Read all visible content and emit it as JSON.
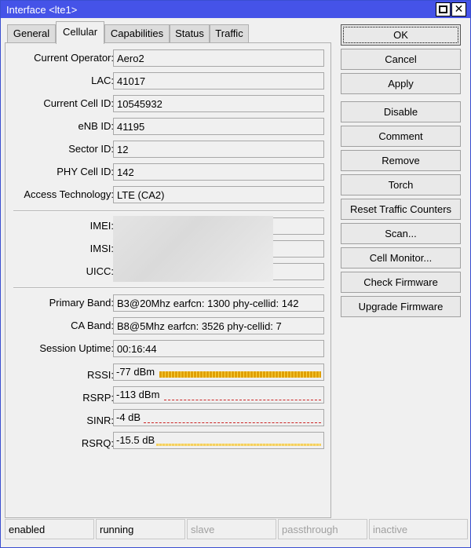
{
  "window": {
    "title": "Interface <lte1>"
  },
  "tabs": [
    {
      "label": "General"
    },
    {
      "label": "Cellular"
    },
    {
      "label": "Capabilities"
    },
    {
      "label": "Status"
    },
    {
      "label": "Traffic"
    }
  ],
  "active_tab": "Cellular",
  "fields": {
    "current_operator": {
      "label": "Current Operator:",
      "value": "Aero2"
    },
    "lac": {
      "label": "LAC:",
      "value": "41017"
    },
    "current_cell_id": {
      "label": "Current Cell ID:",
      "value": "10545932"
    },
    "enb_id": {
      "label": "eNB ID:",
      "value": "41195"
    },
    "sector_id": {
      "label": "Sector ID:",
      "value": "12"
    },
    "phy_cell_id": {
      "label": "PHY Cell ID:",
      "value": "142"
    },
    "access_technology": {
      "label": "Access Technology:",
      "value": "LTE (CA2)"
    },
    "imei": {
      "label": "IMEI:",
      "value": ""
    },
    "imsi": {
      "label": "IMSI:",
      "value": ""
    },
    "uicc": {
      "label": "UICC:",
      "value": ""
    },
    "primary_band": {
      "label": "Primary Band:",
      "value": "B3@20Mhz earfcn: 1300 phy-cellid: 142"
    },
    "ca_band": {
      "label": "CA Band:",
      "value": "B8@5Mhz earfcn: 3526 phy-cellid: 7"
    },
    "session_uptime": {
      "label": "Session Uptime:",
      "value": "00:16:44"
    }
  },
  "signal": {
    "rssi": {
      "label": "RSSI:",
      "value": "-77 dBm",
      "level": 1.0
    },
    "rsrp": {
      "label": "RSRP:",
      "value": "-113 dBm",
      "level": 0
    },
    "sinr": {
      "label": "SINR:",
      "value": "-4 dB",
      "level": 0
    },
    "rsrq": {
      "label": "RSRQ:",
      "value": "-15.5 dB",
      "level": 1.0
    }
  },
  "buttons": {
    "ok": "OK",
    "cancel": "Cancel",
    "apply": "Apply",
    "disable": "Disable",
    "comment": "Comment",
    "remove": "Remove",
    "torch": "Torch",
    "reset_traffic_counters": "Reset Traffic Counters",
    "scan": "Scan...",
    "cell_monitor": "Cell Monitor...",
    "check_firmware": "Check Firmware",
    "upgrade_firmware": "Upgrade Firmware"
  },
  "status_bar": {
    "enabled": "enabled",
    "running": "running",
    "slave": "slave",
    "passthrough": "passthrough",
    "inactive": "inactive"
  },
  "colors": {
    "titlebar": "#4553e8",
    "meter_good": "#e0a000",
    "meter_bad": "#cc2222",
    "meter_fair": "#f5d060"
  }
}
